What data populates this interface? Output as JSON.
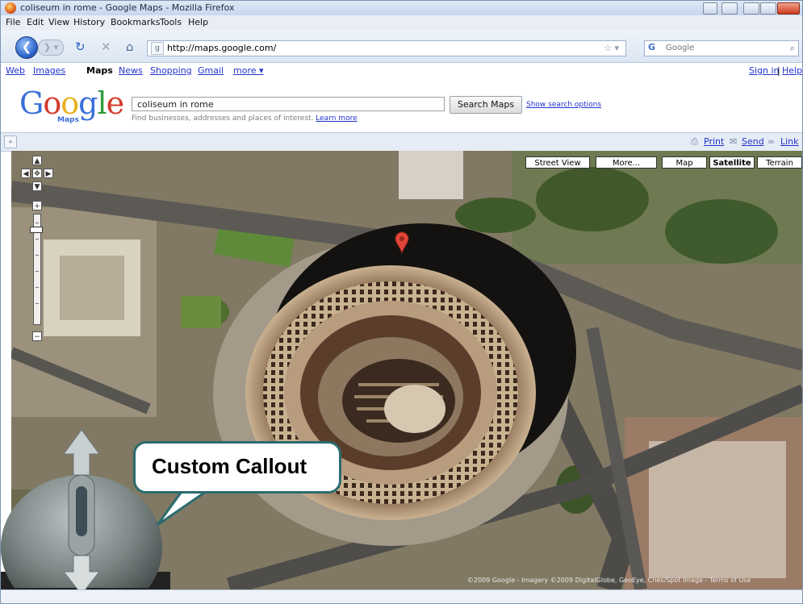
{
  "window": {
    "title": "coliseum in rome - Google Maps - Mozilla Firefox"
  },
  "menu": {
    "items": [
      "File",
      "Edit",
      "View",
      "History",
      "Bookmarks",
      "Tools",
      "Help"
    ]
  },
  "nav": {
    "url": "http://maps.google.com/",
    "search_placeholder": "Google",
    "search_engine_glyph": "G"
  },
  "google_links": {
    "items": [
      "Web",
      "Images",
      "Maps",
      "News",
      "Shopping",
      "Gmail",
      "more ▾"
    ],
    "active": "Maps",
    "sign_in": "Sign in",
    "separator": "|",
    "help": "Help"
  },
  "header": {
    "logo_letters": [
      "G",
      "o",
      "o",
      "g",
      "l",
      "e"
    ],
    "logo_sub": "Maps",
    "search_value": "coliseum in rome",
    "search_button": "Search Maps",
    "show_options": "Show search options",
    "hint": "Find businesses, addresses and places of interest.",
    "learn_more": "Learn more"
  },
  "link_bar": {
    "print": "Print",
    "send": "Send",
    "link": "Link"
  },
  "map": {
    "type_buttons": [
      "Street View",
      "More...",
      "Map",
      "Satellite",
      "Terrain"
    ],
    "selected_type": "Satellite",
    "copyright": "©2009 Google - Imagery ©2009 DigitalGlobe, GeoEye, Cnes/Spot Image - Terms of Use",
    "callout": "Custom Callout"
  },
  "colors": {
    "accent": "#2b6b6f",
    "link": "#2233cc",
    "chrome": "#dce6f3",
    "marker": "#e0473a"
  }
}
